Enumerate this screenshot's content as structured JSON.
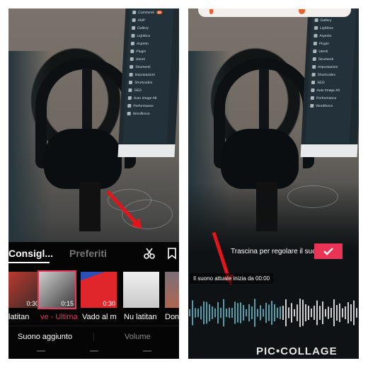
{
  "colors": {
    "accent_pink": "#ea3456",
    "selected_title": "#e8365c",
    "waveform_played": "#5fc3d3",
    "waveform_unplayed": "#ffffff",
    "arrow_red": "#e3151b"
  },
  "monitor_menu": {
    "items": [
      {
        "label": "Commenti",
        "badge": "99"
      },
      {
        "label": "AMP"
      },
      {
        "label": "Gallery"
      },
      {
        "label": "Lightbox"
      },
      {
        "label": "Aspetto"
      },
      {
        "label": "Plugin"
      },
      {
        "label": "Utenti"
      },
      {
        "label": "Strumenti"
      },
      {
        "label": "Impostazioni"
      },
      {
        "label": "Shortcodes"
      },
      {
        "label": "SEO"
      },
      {
        "label": "Auto Image Alt"
      },
      {
        "label": "Performance"
      },
      {
        "label": "Wordfence"
      }
    ]
  },
  "left": {
    "tabs": [
      {
        "label": "Consigl...",
        "active": true
      },
      {
        "label": "Preferiti",
        "active": false
      }
    ],
    "icons": {
      "cut": "scissors-icon",
      "bookmark": "bookmark-icon"
    },
    "tracks": [
      {
        "title": "latitan",
        "duration": "0:30",
        "selected": false
      },
      {
        "title": "ve - Ultima",
        "duration": "0:15",
        "selected": true
      },
      {
        "title": "Vado al m",
        "duration": "0:30",
        "selected": false
      },
      {
        "title": "Nu latitan",
        "duration": "",
        "selected": false
      },
      {
        "title": "Don",
        "duration": "",
        "selected": false
      }
    ],
    "bottom_tabs": {
      "sound": "Suono aggiunto",
      "volume": "Volume"
    }
  },
  "right": {
    "drag_hint": "Trascina per regolare il suono",
    "confirm_icon": "checkmark-icon",
    "tooltip": "Il suono attuale inizia da 00:00",
    "waveform_played_fraction": 0.55
  },
  "watermark": "PIC•COLLAGE"
}
